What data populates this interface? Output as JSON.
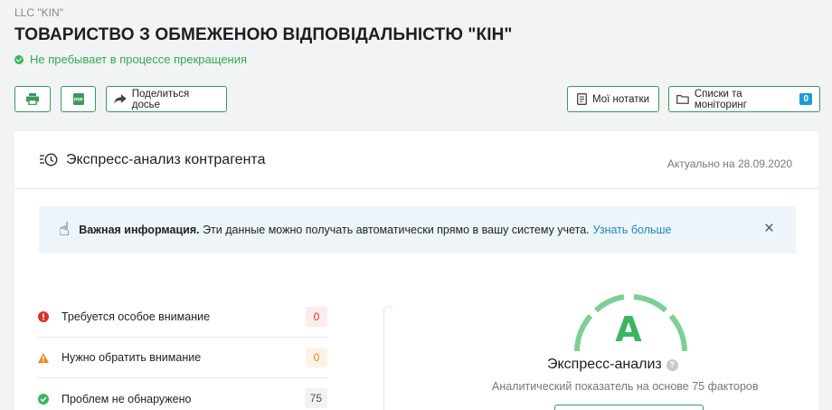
{
  "company": {
    "name_eng": "LLC \"KIN\"",
    "name_full": "ТОВАРИСТВО З ОБМЕЖЕНОЮ ВІДПОВІДАЛЬНІСТЮ \"КІН\"",
    "status": "Не пребывает в процессе прекращения"
  },
  "toolbar": {
    "print_icon": "printer-icon",
    "pdf_icon": "pdf-icon",
    "pdf_text": "PDF",
    "share_label": "Поделиться досье",
    "notes_label": "Мої нотатки",
    "lists_label": "Списки та моніторинг",
    "lists_count": "0"
  },
  "express": {
    "title": "Экспресс-анализ контрагента",
    "actual": "Актуально на 28.09.2020",
    "info_bold": "Важная информация.",
    "info_text": " Эти данные можно получать автоматически прямо в вашу систему учета.",
    "info_link": "Узнать больше",
    "close": "×",
    "checks": [
      {
        "label": "Требуется особое внимание",
        "count": "0",
        "status": "critical"
      },
      {
        "label": "Нужно обратить внимание",
        "count": "0",
        "status": "warning"
      },
      {
        "label": "Проблем не обнаружено",
        "count": "75",
        "status": "ok"
      }
    ],
    "grade": "A",
    "score_title": "Экспресс-анализ",
    "score_sub": "Аналитический показатель на основе 75 факторов"
  },
  "colors": {
    "accent": "#3cb562",
    "border": "#3a9a5c",
    "link": "#1f86c2",
    "badge": "#1e9bd7",
    "info_bg": "#edf5fb",
    "danger": "#d9302b",
    "warning": "#e58a25"
  }
}
